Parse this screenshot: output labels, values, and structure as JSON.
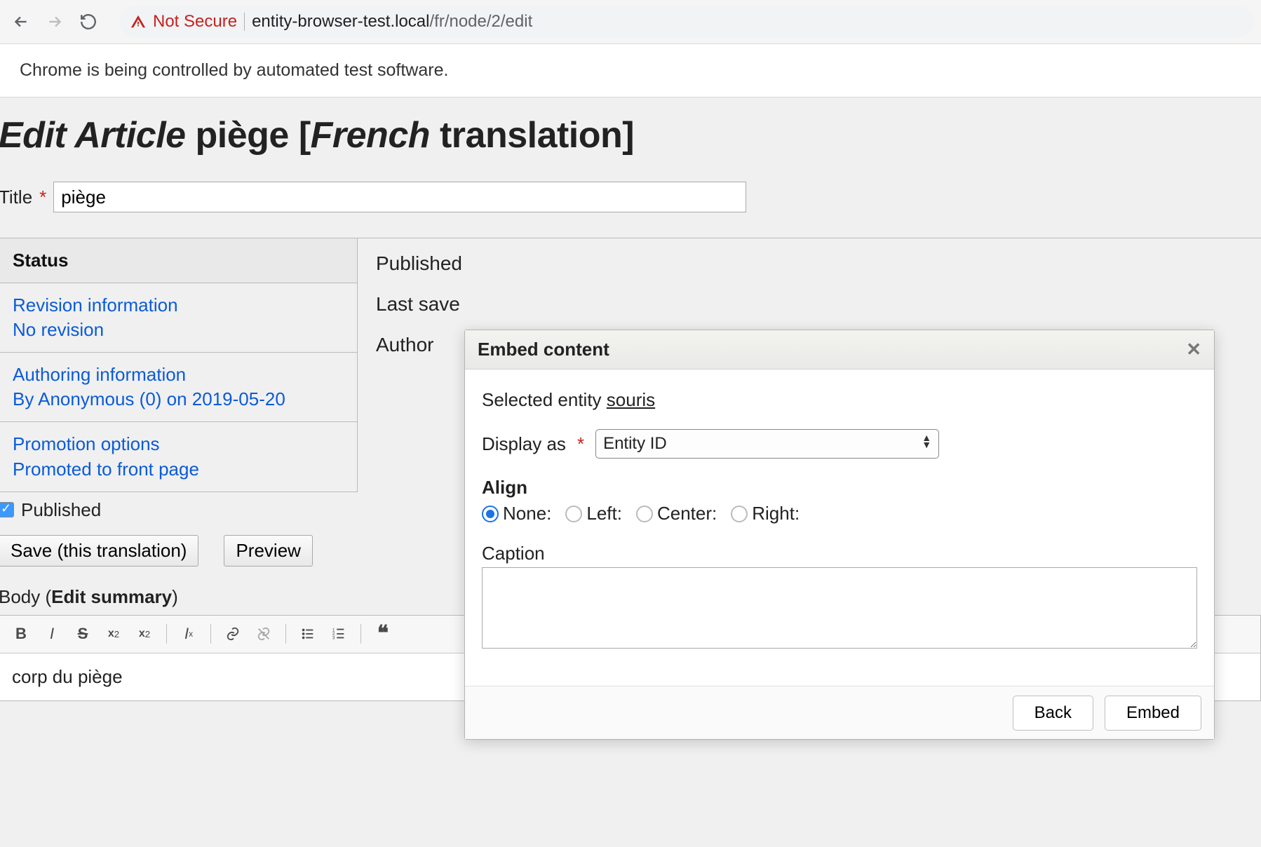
{
  "browser": {
    "not_secure": "Not Secure",
    "url_host": "entity-browser-test.local",
    "url_path": "/fr/node/2/edit"
  },
  "automation_banner": "Chrome is being controlled by automated test software.",
  "page_title": {
    "edit_article": "Edit Article",
    "node_title": "piège",
    "bracket_open": "[",
    "lang": "French",
    "translation": "translation",
    "bracket_close": "]"
  },
  "title_field": {
    "label": "Title",
    "value": "piège"
  },
  "vtabs": {
    "status": {
      "title": "Status"
    },
    "revision": {
      "title": "Revision information",
      "sub": "No revision"
    },
    "authoring": {
      "title": "Authoring information",
      "sub": "By Anonymous (0) on 2019-05-20"
    },
    "promotion": {
      "title": "Promotion options",
      "sub": "Promoted to front page"
    }
  },
  "meta_right": {
    "published": "Published",
    "last_saved": "Last save",
    "author": "Author"
  },
  "published_checkbox": "Published",
  "buttons": {
    "save": "Save (this translation)",
    "preview": "Preview"
  },
  "body": {
    "label": "Body",
    "edit_summary": "Edit summary",
    "content": "corp du piège"
  },
  "modal": {
    "title": "Embed content",
    "selected_entity_label": "Selected entity",
    "selected_entity_name": "souris",
    "display_as": "Display as",
    "display_value": "Entity ID",
    "align_label": "Align",
    "align_options": {
      "none": "None:",
      "left": "Left:",
      "center": "Center:",
      "right": "Right:"
    },
    "caption_label": "Caption",
    "caption_value": "",
    "back": "Back",
    "embed": "Embed"
  }
}
